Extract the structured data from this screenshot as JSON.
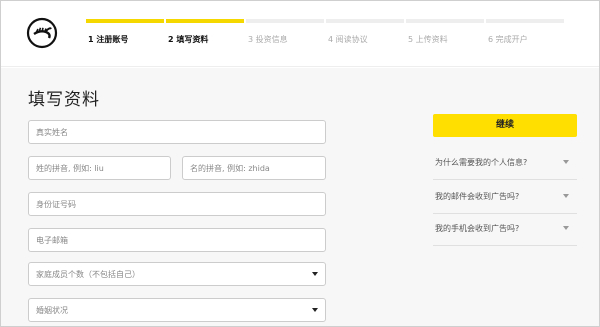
{
  "header": {
    "steps": [
      {
        "label": "1 注册账号",
        "done": true
      },
      {
        "label": "2 填写资料",
        "done": true
      },
      {
        "label": "3 投资信息",
        "done": false
      },
      {
        "label": "4 阅读协议",
        "done": false
      },
      {
        "label": "5 上传资料",
        "done": false
      },
      {
        "label": "6 完成开户",
        "done": false
      }
    ]
  },
  "main": {
    "title": "填写资料",
    "fields": {
      "real_name": {
        "placeholder": "真实姓名"
      },
      "last_name_pinyin": {
        "placeholder": "姓的拼音, 例如: liu"
      },
      "first_name_pinyin": {
        "placeholder": "名的拼音, 例如: zhida"
      },
      "id_number": {
        "placeholder": "身份证号码"
      },
      "email": {
        "placeholder": "电子邮箱"
      },
      "family_members": {
        "placeholder": "家庭成员个数（不包括自己）"
      },
      "marital_status": {
        "placeholder": "婚姻状况"
      }
    }
  },
  "sidebar": {
    "continue_label": "继续",
    "faqs": [
      {
        "question": "为什么需要我的个人信息?"
      },
      {
        "question": "我的邮件会收到广告吗?"
      },
      {
        "question": "我的手机会收到广告吗?"
      }
    ]
  },
  "colors": {
    "accent": "#ffdf00",
    "progress_done": "#f5d800",
    "progress_todo": "#eeeeee",
    "background": "#f7f7f7"
  }
}
